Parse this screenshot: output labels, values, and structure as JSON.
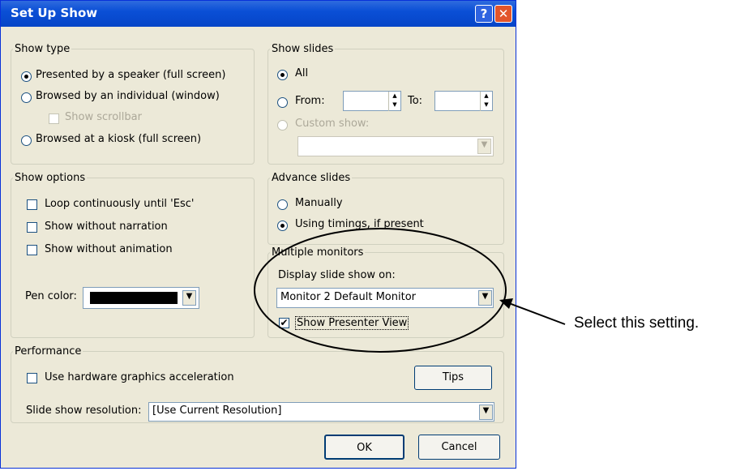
{
  "dialog": {
    "title": "Set Up Show",
    "help_glyph": "?",
    "close_glyph": "✕"
  },
  "show_type": {
    "legend": "Show type",
    "presented_label": "Presented by a speaker (full screen)",
    "browsed_individual_label": "Browsed by an individual (window)",
    "show_scrollbar_label": "Show scrollbar",
    "kiosk_label": "Browsed at a kiosk (full screen)"
  },
  "show_slides": {
    "legend": "Show slides",
    "all_label": "All",
    "from_label": "From:",
    "to_label": "To:",
    "from_value": "",
    "to_value": "",
    "custom_show_label": "Custom show:",
    "custom_show_value": ""
  },
  "show_options": {
    "legend": "Show options",
    "loop_label": "Loop continuously until 'Esc'",
    "no_narration_label": "Show without narration",
    "no_animation_label": "Show without animation",
    "pen_color_label": "Pen color:",
    "pen_color": "#000000"
  },
  "advance_slides": {
    "legend": "Advance slides",
    "manually_label": "Manually",
    "timings_label": "Using timings, if present"
  },
  "multiple_monitors": {
    "legend": "Multiple monitors",
    "display_on_label": "Display slide show on:",
    "display_on_value": "Monitor 2 Default Monitor",
    "presenter_view_label": "Show Presenter View",
    "presenter_view_checked": "✔"
  },
  "performance": {
    "legend": "Performance",
    "hw_accel_label": "Use hardware graphics acceleration",
    "tips_label": "Tips",
    "resolution_label": "Slide show resolution:",
    "resolution_value": "[Use Current Resolution]"
  },
  "footer": {
    "ok_label": "OK",
    "cancel_label": "Cancel"
  },
  "annotation": {
    "text": "Select this setting."
  },
  "colors": {
    "titlebar": "#0a4fd6",
    "dialog_bg": "#ece9d8",
    "close_button": "#e2552b"
  }
}
